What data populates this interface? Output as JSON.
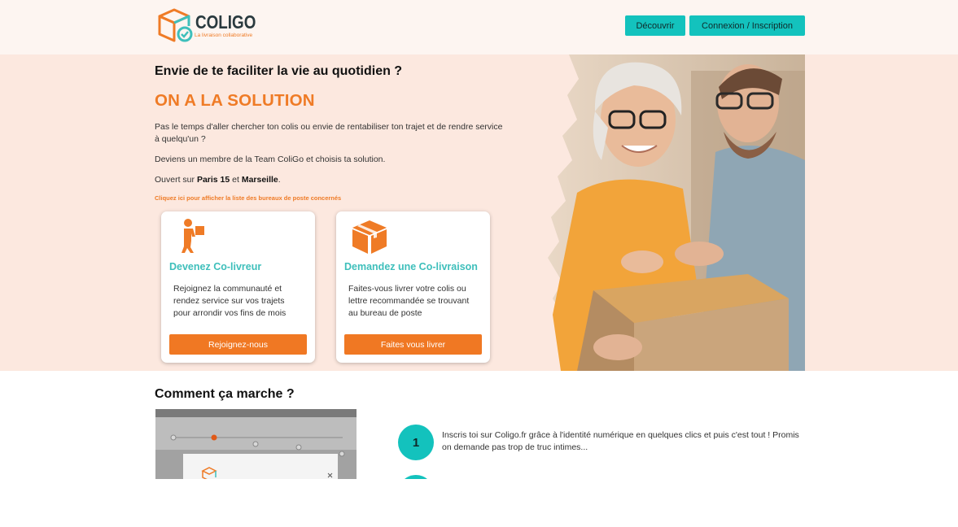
{
  "header": {
    "logo_name": "COLIGO",
    "logo_tagline": "La livraison collaborative",
    "nav": {
      "discover": "Découvrir",
      "login": "Connexion / Inscription"
    }
  },
  "hero": {
    "title": "Envie de te faciliter la vie au quotidien ?",
    "slogan": "ON A LA SOLUTION",
    "p1": "Pas le temps d'aller chercher ton colis ou envie de rentabiliser ton trajet et de rendre service à quelqu'un ?",
    "p2": "Deviens un membre de la Team ColiGo et choisis ta solution.",
    "p3_prefix": "Ouvert sur ",
    "p3_city1": "Paris 15",
    "p3_mid": " et ",
    "p3_city2": "Marseille",
    "p3_suffix": ".",
    "link": "Cliquez ici pour afficher la liste des bureaux de poste concernés"
  },
  "cards": [
    {
      "icon": "delivery-person-icon",
      "title": "Devenez Co-livreur",
      "text": "Rejoignez la communauté et rendez service sur vos trajets pour arrondir vos fins de mois",
      "button": "Rejoignez-nous"
    },
    {
      "icon": "package-box-icon",
      "title": "Demandez une Co-livraison",
      "text": "Faites-vous livrer votre colis ou lettre recommandée se trouvant au bureau de poste",
      "button": "Faites vous livrer"
    }
  ],
  "how": {
    "title": "Comment ça marche ?",
    "steps": [
      {
        "number": "1",
        "text": "Inscris toi sur Coligo.fr grâce à l'identité numérique en quelques clics et puis c'est tout ! Promis on demande pas trop de truc intimes..."
      }
    ]
  },
  "colors": {
    "accent_teal": "#13c2bd",
    "accent_orange": "#ef7b26",
    "hero_bg": "#fce8df",
    "header_bg": "#fdf5f1"
  }
}
